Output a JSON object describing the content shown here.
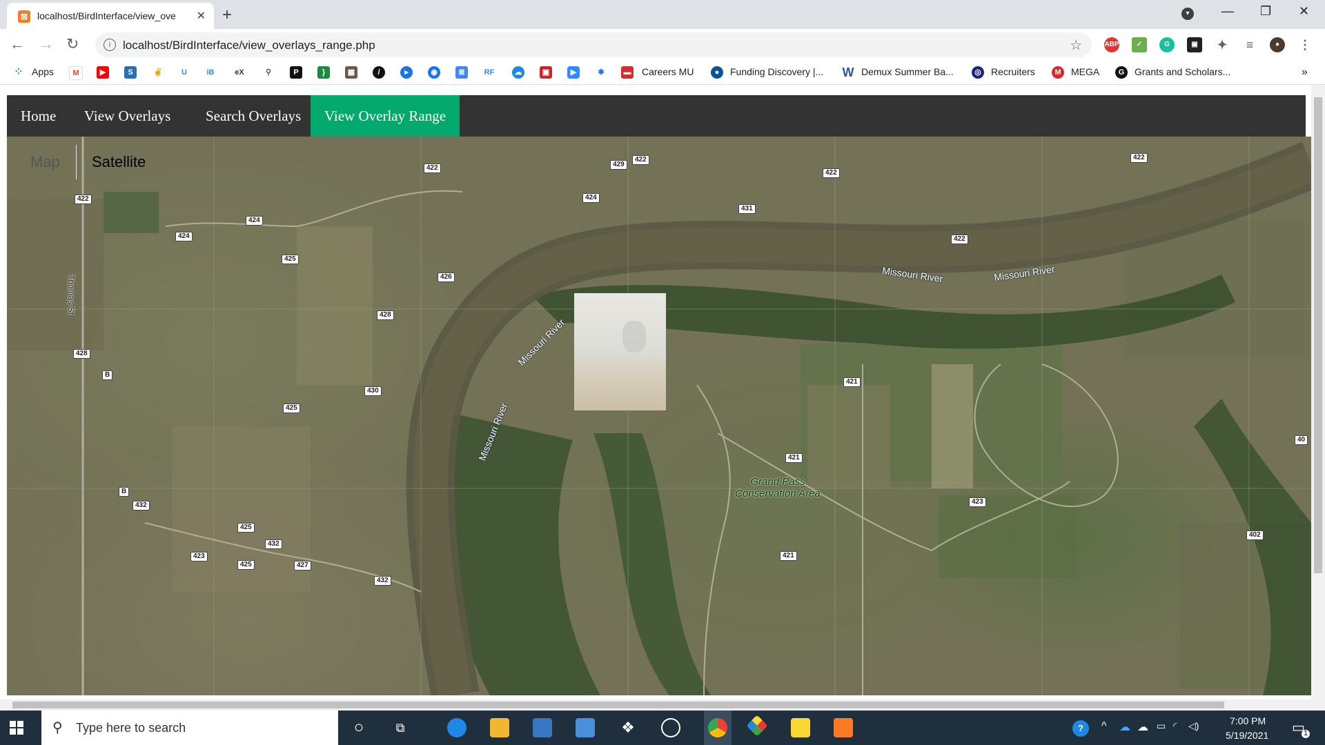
{
  "browser": {
    "tab_title": "localhost/BirdInterface/view_ove",
    "url": "localhost/BirdInterface/view_overlays_range.php",
    "bookmarks": [
      {
        "label": "Apps"
      },
      {
        "label": "Careers MU"
      },
      {
        "label": "Funding Discovery |..."
      },
      {
        "label": "Demux Summer Ba..."
      },
      {
        "label": "Recruiters"
      },
      {
        "label": "MEGA"
      },
      {
        "label": "Grants and Scholars..."
      }
    ],
    "more_bookmarks": "»"
  },
  "nav": {
    "items": [
      {
        "label": "Home"
      },
      {
        "label": "View Overlays"
      },
      {
        "label": "Search Overlays"
      },
      {
        "label": "View Overlay Range"
      }
    ],
    "active": "View Overlay Range",
    "active_color": "#04AA6D"
  },
  "map": {
    "type_control": {
      "map": "Map",
      "satellite": "Satellite",
      "selected": "Satellite"
    },
    "street_labels": [
      "Thomas St"
    ],
    "river_labels": [
      "Missouri River",
      "Missouri River",
      "Missouri River",
      "Missouri River"
    ],
    "poi": {
      "name": "Grand Pass Conservation Area"
    },
    "route_shields": [
      "422",
      "429",
      "422",
      "422",
      "422",
      "424",
      "431",
      "422",
      "424",
      "424",
      "422",
      "425",
      "426",
      "428",
      "428",
      "430",
      "425",
      "421",
      "421",
      "423",
      "432",
      "425",
      "432",
      "423",
      "425",
      "427",
      "432",
      "421",
      "402",
      "40",
      "B",
      "B"
    ]
  },
  "taskbar": {
    "search_placeholder": "Type here to search",
    "time": "7:00 PM",
    "date": "5/19/2021",
    "notification_count": "1"
  }
}
